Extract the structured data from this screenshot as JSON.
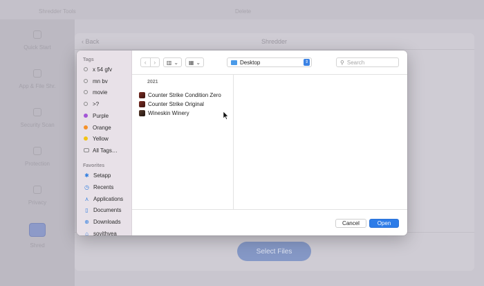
{
  "background_app": {
    "topbar_left": "Shredder Tools",
    "topbar_center": "Delete",
    "sidebar_items": [
      "Quick Start",
      "App & File Shr.",
      "Security Scan",
      "Protection",
      "Privacy",
      "Shred"
    ],
    "back_label": "Back",
    "title": "Shredder",
    "select_files_label": "Select Files"
  },
  "dialog": {
    "sidebar": {
      "tags_header": "Tags",
      "tags": [
        {
          "label": "x 54   gfv",
          "color": ""
        },
        {
          "label": "mn bv",
          "color": ""
        },
        {
          "label": "movie",
          "color": ""
        },
        {
          "label": ">?",
          "color": ""
        },
        {
          "label": "Purple",
          "color": "#a356d6"
        },
        {
          "label": "Orange",
          "color": "#f5912a"
        },
        {
          "label": "Yellow",
          "color": "#f2c315"
        },
        {
          "label": "All Tags…",
          "color": ""
        }
      ],
      "favorites_header": "Favorites",
      "favorites": [
        {
          "label": "Setapp",
          "icon": "setapp-icon"
        },
        {
          "label": "Recents",
          "icon": "clock-icon"
        },
        {
          "label": "Applications",
          "icon": "applications-icon"
        },
        {
          "label": "Documents",
          "icon": "document-icon"
        },
        {
          "label": "Downloads",
          "icon": "download-icon"
        },
        {
          "label": "sovithvea",
          "icon": "home-icon"
        }
      ]
    },
    "toolbar": {
      "location": "Desktop",
      "search_placeholder": "Search"
    },
    "browser": {
      "group_label": "2021",
      "files": [
        "Counter Strike Condition Zero",
        "Counter Strike Original",
        "Wineskin Winery"
      ]
    },
    "footer": {
      "cancel_label": "Cancel",
      "open_label": "Open"
    }
  },
  "colors": {
    "accent": "#2d7ce8",
    "sidebar_bg": "#e8e1e8"
  }
}
